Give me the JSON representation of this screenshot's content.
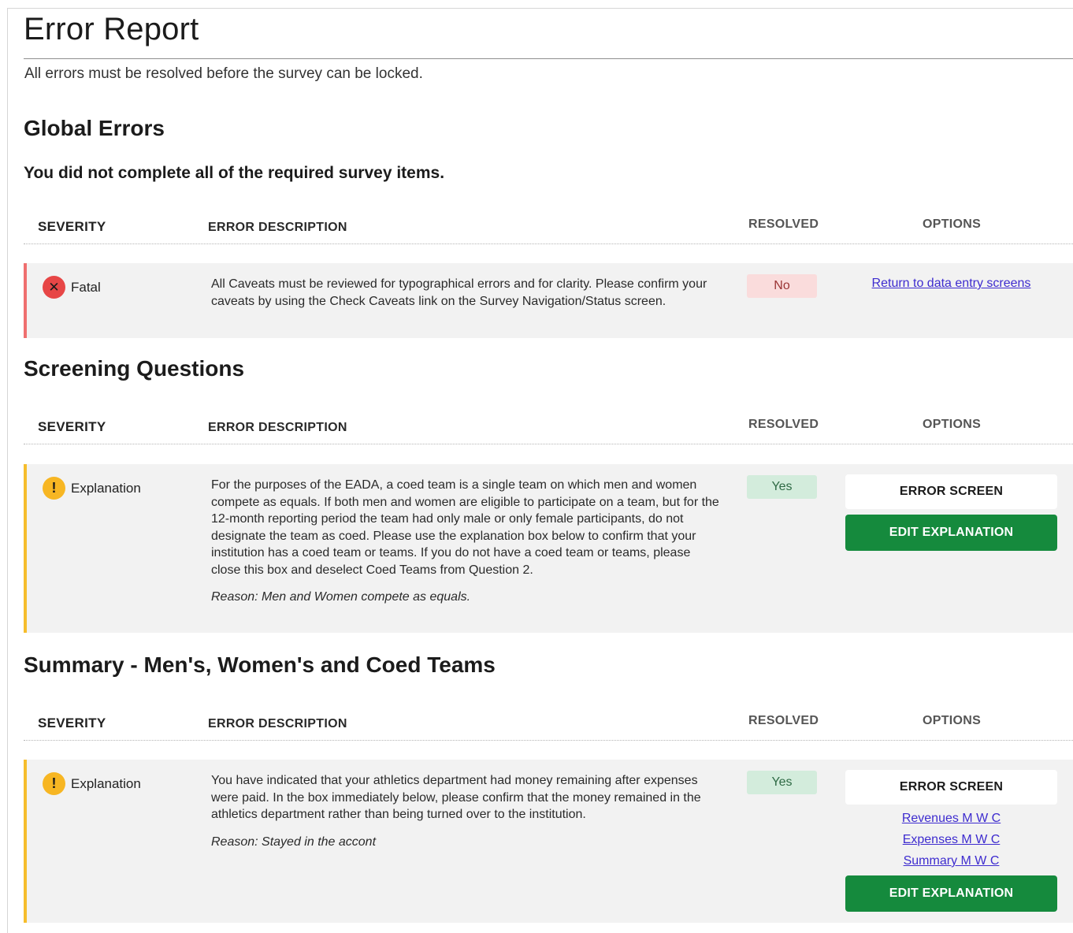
{
  "page": {
    "title": "Error Report",
    "intro": "All errors must be resolved before the survey can be locked."
  },
  "columns": {
    "severity": "SEVERITY",
    "description": "ERROR DESCRIPTION",
    "resolved": "RESOLVED",
    "options": "OPTIONS"
  },
  "sections": [
    {
      "title": "Global Errors",
      "subtitle": "You did not complete all of the required survey items.",
      "rows": [
        {
          "severity": "Fatal",
          "severity_icon": "error-x-icon",
          "description": "All Caveats must be reviewed for typographical errors and for clarity. Please confirm your caveats by using the Check Caveats link on the Survey Navigation/Status screen.",
          "resolved": "No",
          "option_link": "Return to data entry screens"
        }
      ]
    },
    {
      "title": "Screening Questions",
      "rows": [
        {
          "severity": "Explanation",
          "severity_icon": "warning-exclamation-icon",
          "description": "For the purposes of the EADA, a coed team is a single team on which men and women compete as equals. If both men and women are eligible to participate on a team, but for the 12-month reporting period the team had only male or only female participants, do not designate the team as coed. Please use the explanation box below to confirm that your institution has a coed team or teams. If you do not have a coed team or teams, please close this box and deselect Coed Teams from Question 2.",
          "reason": "Reason: Men and Women compete as equals.",
          "resolved": "Yes",
          "error_screen_label": "ERROR SCREEN",
          "edit_label": "EDIT EXPLANATION"
        }
      ]
    },
    {
      "title": "Summary - Men's, Women's and Coed Teams",
      "rows": [
        {
          "severity": "Explanation",
          "severity_icon": "warning-exclamation-icon",
          "description": "You have indicated that your athletics department had money remaining after expenses were paid. In the box immediately below, please confirm that the money remained in the athletics department rather than being turned over to the institution.",
          "reason": "Reason: Stayed in the accont",
          "resolved": "Yes",
          "error_screen_label": "ERROR SCREEN",
          "links": [
            "Revenues M W C",
            "Expenses M W C",
            "Summary M W C"
          ],
          "edit_label": "EDIT EXPLANATION"
        }
      ]
    }
  ],
  "colors": {
    "fatal_bar": "#ef6f6f",
    "warning_bar": "#f6bd2c",
    "primary_green": "#158a3d",
    "link": "#3e2ccf"
  }
}
